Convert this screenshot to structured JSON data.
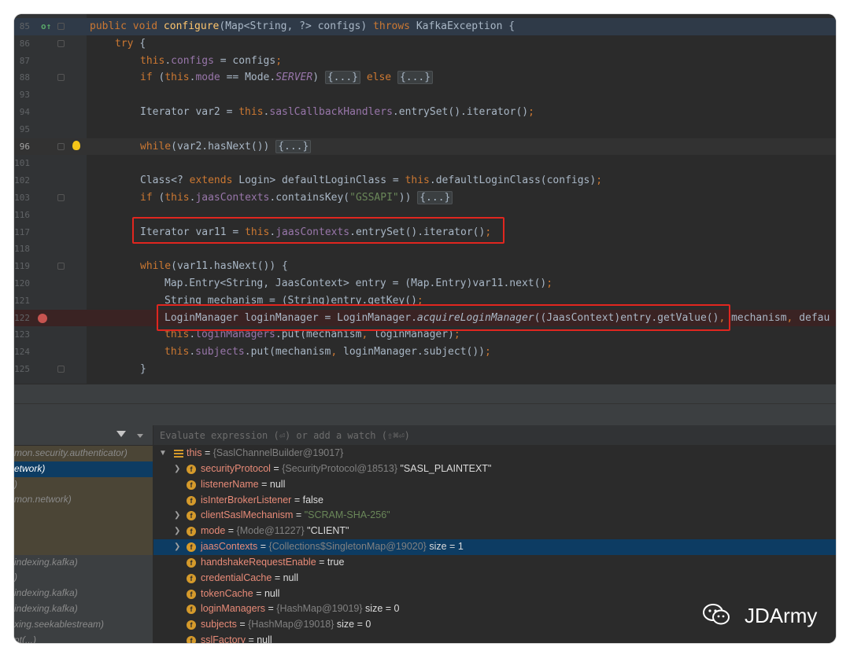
{
  "editor": {
    "lines": [
      {
        "num": "85"
      },
      {
        "num": "86"
      },
      {
        "num": "87"
      },
      {
        "num": "88"
      },
      {
        "num": "93"
      },
      {
        "num": "94"
      },
      {
        "num": "95"
      },
      {
        "num": "96"
      },
      {
        "num": "101"
      },
      {
        "num": "102"
      },
      {
        "num": "103"
      },
      {
        "num": "116"
      },
      {
        "num": "117"
      },
      {
        "num": "118"
      },
      {
        "num": "119"
      },
      {
        "num": "120"
      },
      {
        "num": "121"
      },
      {
        "num": "122"
      },
      {
        "num": "123"
      },
      {
        "num": "124"
      },
      {
        "num": "125"
      }
    ]
  },
  "debugger": {
    "eval_placeholder": "Evaluate expression (⏎) or add a watch (⇧⌘⏎)",
    "frames": [
      "mon.security.authenticator)",
      "etwork)",
      ")",
      "mon.network)",
      "",
      "",
      "",
      "indexing.kafka)",
      ")",
      "indexing.kafka)",
      "indexing.kafka)",
      "xing.seekablestream)",
      "nt(...)"
    ],
    "variables": [
      {
        "name": "this",
        "type": "{SaslChannelBuilder@19017}",
        "value": ""
      },
      {
        "name": "securityProtocol",
        "type": "{SecurityProtocol@18513}",
        "value": "\"SASL_PLAINTEXT\""
      },
      {
        "name": "listenerName",
        "type": "",
        "value": "null"
      },
      {
        "name": "isInterBrokerListener",
        "type": "",
        "value": "false"
      },
      {
        "name": "clientSaslMechanism",
        "type": "",
        "value": "\"SCRAM-SHA-256\""
      },
      {
        "name": "mode",
        "type": "{Mode@11227}",
        "value": "\"CLIENT\""
      },
      {
        "name": "jaasContexts",
        "type": "{Collections$SingletonMap@19020}",
        "value": "size = 1"
      },
      {
        "name": "handshakeRequestEnable",
        "type": "",
        "value": "true"
      },
      {
        "name": "credentialCache",
        "type": "",
        "value": "null"
      },
      {
        "name": "tokenCache",
        "type": "",
        "value": "null"
      },
      {
        "name": "loginManagers",
        "type": "{HashMap@19019}",
        "value": "size = 0"
      },
      {
        "name": "subjects",
        "type": "{HashMap@19018}",
        "value": "size = 0"
      },
      {
        "name": "sslFactory",
        "type": "",
        "value": "null"
      }
    ]
  },
  "watermark": {
    "text": "JDArmy"
  }
}
